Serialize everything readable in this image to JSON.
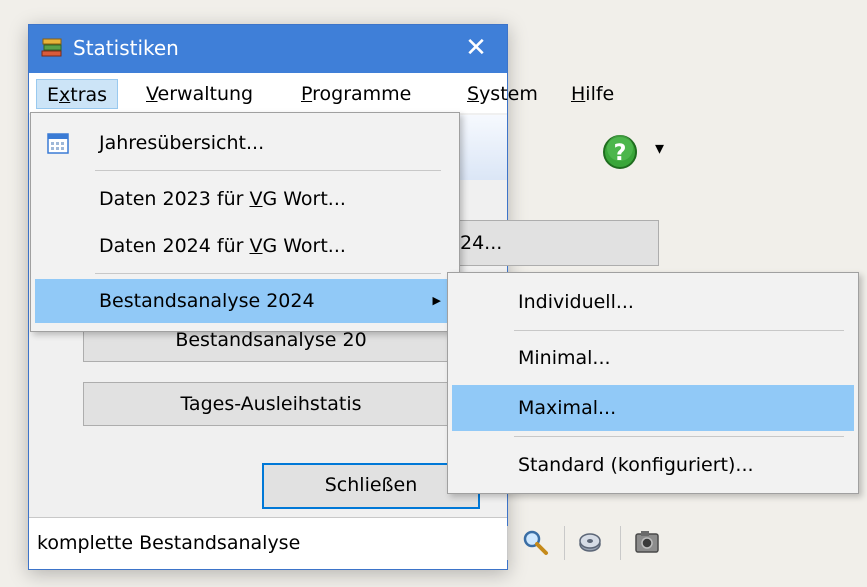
{
  "window": {
    "title": "Statistiken",
    "close_glyph": "✕",
    "app_icon": "books-icon"
  },
  "menubar": {
    "items": [
      {
        "label": "Extras",
        "mnemonic": "x",
        "prefix": "E",
        "suffix": "tras"
      },
      {
        "label": "Verwaltung",
        "prefix": "",
        "mnemonic": "V",
        "suffix": "erwaltung"
      },
      {
        "label": "Programme",
        "prefix": "",
        "mnemonic": "P",
        "suffix": "rogramme"
      },
      {
        "label": "System",
        "prefix": "",
        "mnemonic": "S",
        "suffix": "ystem"
      },
      {
        "label": "Hilfe",
        "prefix": "",
        "mnemonic": "H",
        "suffix": "ilfe"
      }
    ]
  },
  "toolbar": {
    "help_icon": "help-circle-icon",
    "dropdown_glyph": "▾"
  },
  "buttons": {
    "b1_visible": "24...",
    "b2_visible": "Bestandsanalyse 20",
    "b3_visible": "Tages-Ausleihstatis",
    "close": "Schließen"
  },
  "statusbar": {
    "text": "komplette Bestandsanalyse",
    "icons": [
      "search-icon",
      "disk-icon",
      "camera-icon"
    ]
  },
  "extras_menu": {
    "items": [
      {
        "label": "Jahresübersicht...",
        "icon": "calendar-icon"
      },
      {
        "label_pre": "Daten 2023 für ",
        "label_u": "V",
        "label_post": "G Wort..."
      },
      {
        "label_pre": "Daten 2024 für ",
        "label_u": "V",
        "label_post": "G Wort..."
      },
      {
        "label": "Bestandsanalyse 2024",
        "submenu_glyph": "▶"
      }
    ]
  },
  "submenu": {
    "items": [
      {
        "label": "Individuell..."
      },
      {
        "label": "Minimal..."
      },
      {
        "label": "Maximal..."
      },
      {
        "label": "Standard (konfiguriert)..."
      }
    ]
  },
  "colors": {
    "titlebar": "#3f7fd8",
    "highlight": "#91c9f7",
    "menu_active": "#cce4f7"
  }
}
